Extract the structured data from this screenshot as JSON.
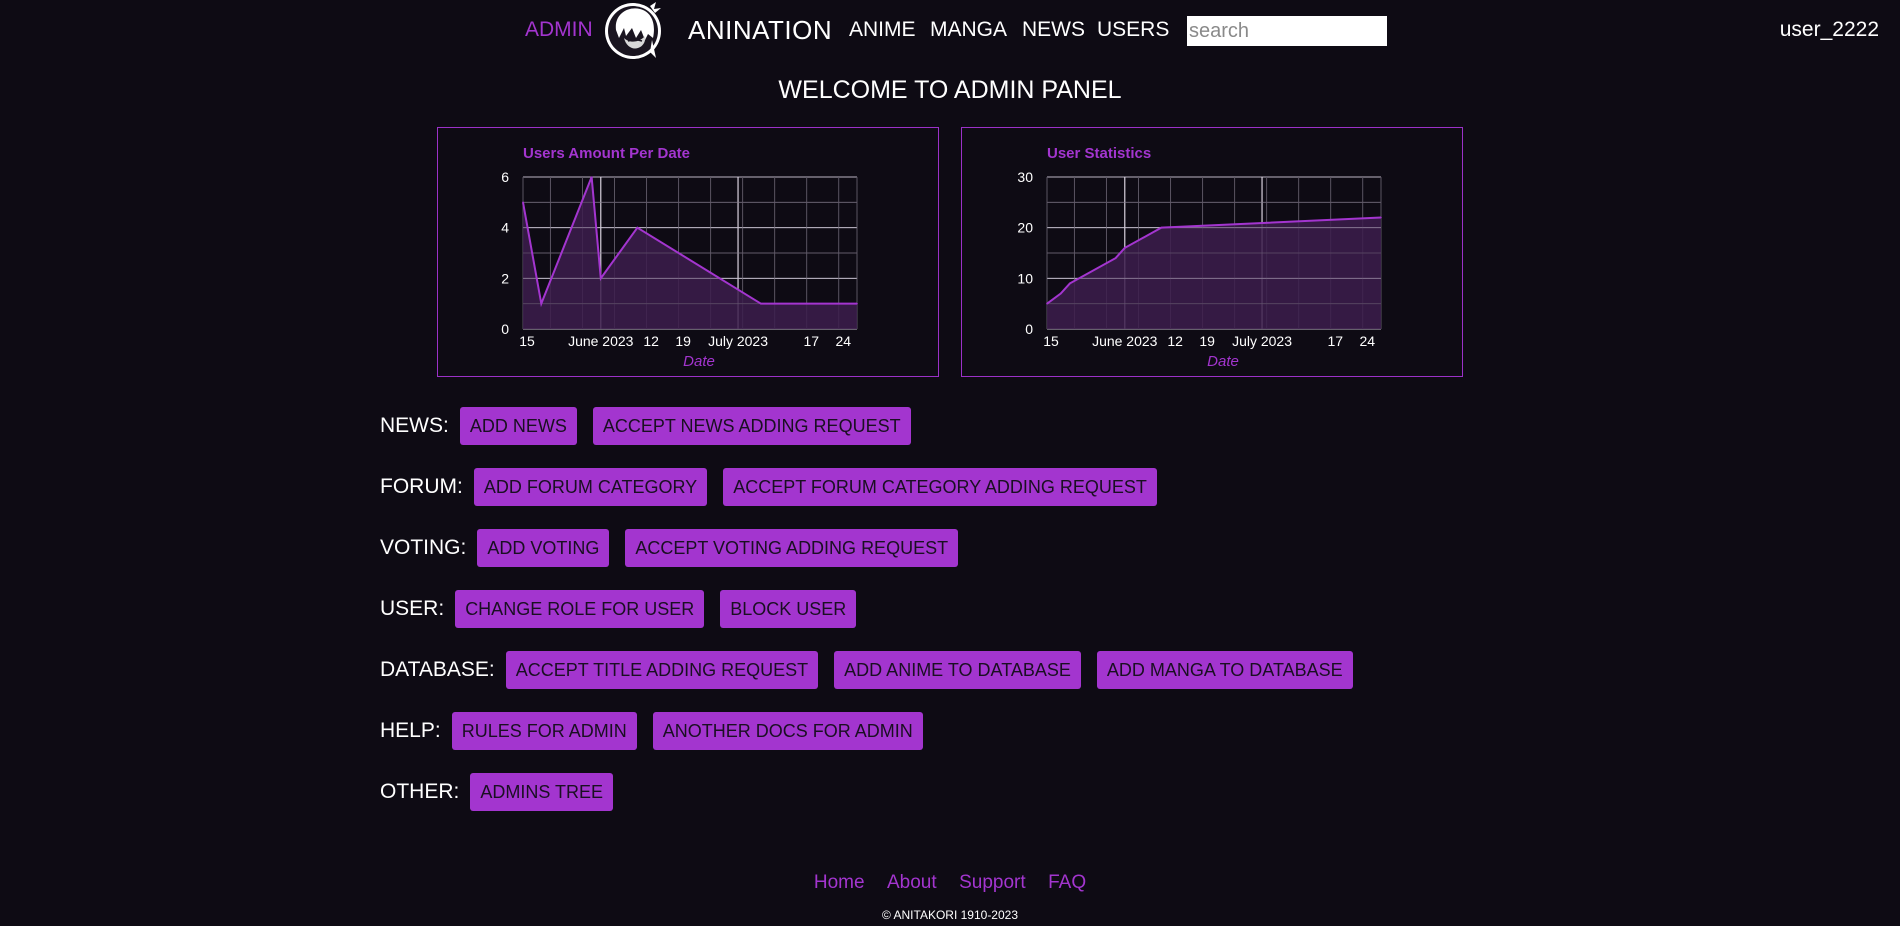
{
  "nav": {
    "admin": "ADMIN",
    "brand": "ANINATION",
    "links": [
      "ANIME",
      "MANGA",
      "NEWS",
      "USERS"
    ],
    "search_placeholder": "search",
    "username": "user_2222",
    "logo_icon": "anime-girl-logo-icon"
  },
  "page_title": "WELCOME TO ADMIN PANEL",
  "colors": {
    "accent": "#a335cf",
    "background": "#0e0b14",
    "area_fill": "#3c1d4c"
  },
  "chart_data": [
    {
      "type": "area",
      "title": "Users Amount Per Date",
      "xlabel": "Date",
      "ylabel": "",
      "x_tick_labels": [
        "15",
        "June 2023",
        "12",
        "19",
        "July 2023",
        "17",
        "24"
      ],
      "y_tick_labels": [
        "0",
        "2",
        "4",
        "6"
      ],
      "ylim": [
        0,
        6
      ],
      "xlim": [
        "2023-05-15",
        "2023-07-27"
      ],
      "grid": true,
      "series": [
        {
          "x": [
            "2023-05-15",
            "2023-05-19",
            "2023-05-30",
            "2023-06-01",
            "2023-06-09",
            "2023-07-06",
            "2023-07-27"
          ],
          "y": [
            5,
            1,
            6,
            2,
            4,
            1,
            1
          ]
        }
      ]
    },
    {
      "type": "area",
      "title": "User Statistics",
      "xlabel": "Date",
      "ylabel": "",
      "x_tick_labels": [
        "15",
        "June 2023",
        "12",
        "19",
        "July 2023",
        "17",
        "24"
      ],
      "y_tick_labels": [
        "0",
        "10",
        "20",
        "30"
      ],
      "ylim": [
        0,
        30
      ],
      "xlim": [
        "2023-05-15",
        "2023-07-27"
      ],
      "grid": true,
      "series": [
        {
          "x": [
            "2023-05-15",
            "2023-05-18",
            "2023-05-20",
            "2023-05-30",
            "2023-06-01",
            "2023-06-09",
            "2023-07-27"
          ],
          "y": [
            5,
            7,
            9,
            14,
            16,
            20,
            22
          ]
        }
      ]
    }
  ],
  "sections": [
    {
      "label": "NEWS:",
      "buttons": [
        "ADD NEWS",
        "ACCEPT NEWS ADDING REQUEST"
      ]
    },
    {
      "label": "FORUM:",
      "buttons": [
        "ADD FORUM CATEGORY",
        "ACCEPT FORUM CATEGORY ADDING REQUEST"
      ]
    },
    {
      "label": "VOTING:",
      "buttons": [
        "ADD VOTING",
        "ACCEPT VOTING ADDING REQUEST"
      ]
    },
    {
      "label": "USER:",
      "buttons": [
        "CHANGE ROLE FOR USER",
        "BLOCK USER"
      ]
    },
    {
      "label": "DATABASE:",
      "buttons": [
        "ACCEPT TITLE ADDING REQUEST",
        "ADD ANIME TO DATABASE",
        "ADD MANGA TO DATABASE"
      ]
    },
    {
      "label": "HELP:",
      "buttons": [
        "RULES FOR ADMIN",
        "ANOTHER DOCS FOR ADMIN"
      ]
    },
    {
      "label": "OTHER:",
      "buttons": [
        "ADMINS TREE"
      ]
    }
  ],
  "footer": {
    "links": [
      "Home",
      "About",
      "Support",
      "FAQ"
    ],
    "copyright": "© ANITAKORI 1910-2023"
  }
}
